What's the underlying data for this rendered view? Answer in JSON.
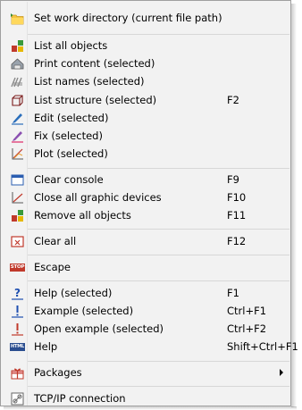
{
  "menu": {
    "items": [
      {
        "label": "Set work directory (current file path)",
        "icon": "folder-icon",
        "shortcut": ""
      },
      {
        "label": "List all objects",
        "icon": "objects-icon",
        "shortcut": ""
      },
      {
        "label": "Print content (selected)",
        "icon": "print-content-icon",
        "shortcut": ""
      },
      {
        "label": "List names (selected)",
        "icon": "list-names-icon",
        "shortcut": ""
      },
      {
        "label": "List structure (selected)",
        "icon": "structure-icon",
        "shortcut": "F2"
      },
      {
        "label": "Edit (selected)",
        "icon": "pen-edit-icon",
        "shortcut": ""
      },
      {
        "label": "Fix (selected)",
        "icon": "pen-fix-icon",
        "shortcut": ""
      },
      {
        "label": "Plot (selected)",
        "icon": "plot-icon",
        "shortcut": ""
      },
      {
        "label": "Clear console",
        "icon": "console-icon",
        "shortcut": "F9"
      },
      {
        "label": "Close all graphic devices",
        "icon": "close-devices-icon",
        "shortcut": "F10"
      },
      {
        "label": "Remove all objects",
        "icon": "remove-objects-icon",
        "shortcut": "F11"
      },
      {
        "label": "Clear all",
        "icon": "clear-all-icon",
        "shortcut": "F12"
      },
      {
        "label": "Escape",
        "icon": "stop-icon",
        "shortcut": ""
      },
      {
        "label": "Help (selected)",
        "icon": "question-icon",
        "shortcut": "F1"
      },
      {
        "label": "Example (selected)",
        "icon": "exclamation-blue-icon",
        "shortcut": "Ctrl+F1"
      },
      {
        "label": "Open example (selected)",
        "icon": "exclamation-red-icon",
        "shortcut": "Ctrl+F2"
      },
      {
        "label": "Help",
        "icon": "html-icon",
        "shortcut": "Shift+Ctrl+F1"
      },
      {
        "label": "Packages",
        "icon": "gift-icon",
        "shortcut": ""
      },
      {
        "label": "TCP/IP connection",
        "icon": "tcpip-icon",
        "shortcut": ""
      }
    ],
    "stop_badge": "STOP",
    "html_badge": "HTML"
  }
}
